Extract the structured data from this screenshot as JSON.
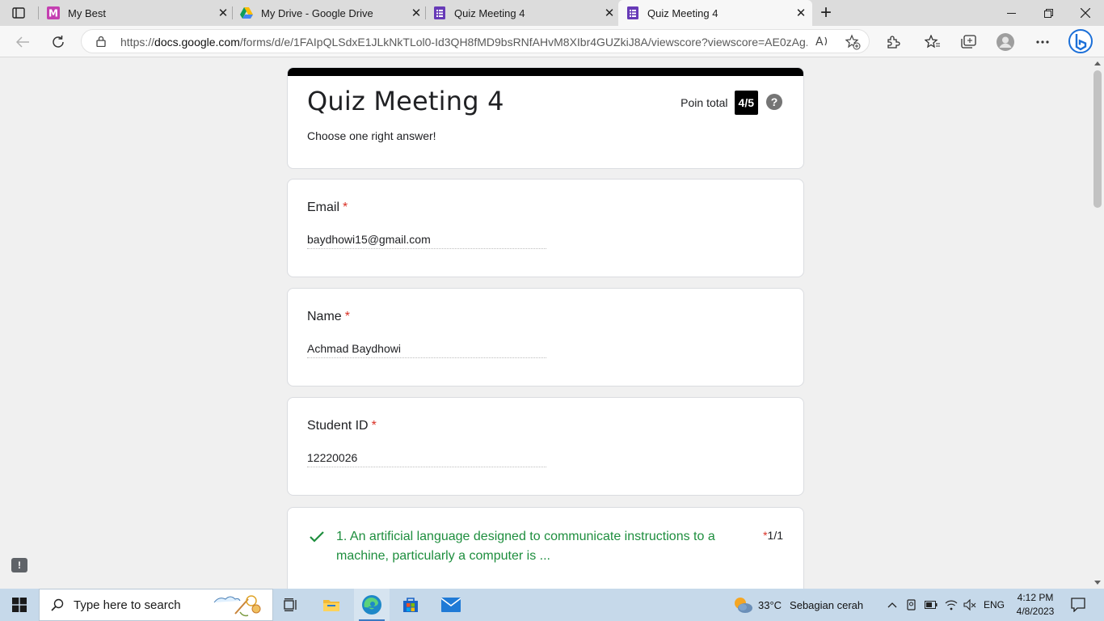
{
  "browser": {
    "tabs": [
      {
        "label": "My Best",
        "icon": "custom-m-icon"
      },
      {
        "label": "My Drive - Google Drive",
        "icon": "google-drive-icon"
      },
      {
        "label": "Quiz Meeting 4",
        "icon": "google-forms-icon"
      },
      {
        "label": "Quiz Meeting 4",
        "icon": "google-forms-icon",
        "active": true
      }
    ],
    "url_prefix": "https://",
    "url_domain": "docs.google.com",
    "url_rest": "/forms/d/e/1FAIpQLSdxE1JLkNkTLol0-Id3QH8fMD9bsRNfAHvM8XIbr4GUZkiJ8A/viewscore?viewscore=AE0zAg..."
  },
  "form": {
    "accent_color": "#000000",
    "title": "Quiz Meeting 4",
    "description": "Choose one right answer!",
    "points_label": "Poin total",
    "points_value": "4/5",
    "help": "?",
    "fields": [
      {
        "label": "Email",
        "required": "*",
        "value": "baydhowi15@gmail.com"
      },
      {
        "label": "Name",
        "required": "*",
        "value": "Achmad Baydhowi"
      },
      {
        "label": "Student ID",
        "required": "*",
        "value": "12220026"
      }
    ],
    "questions": [
      {
        "text": "1. An artificial language designed to communicate instructions to a machine, particularly a computer is ...",
        "required": "*",
        "score": "1/1",
        "correct": true,
        "correct_color": "#1e8e3e"
      }
    ]
  },
  "feedback": "!",
  "taskbar": {
    "search_placeholder": "Type here to search",
    "weather_temp": "33°C",
    "weather_desc": "Sebagian cerah",
    "language": "ENG",
    "time": "4:12 PM",
    "date": "4/8/2023"
  }
}
